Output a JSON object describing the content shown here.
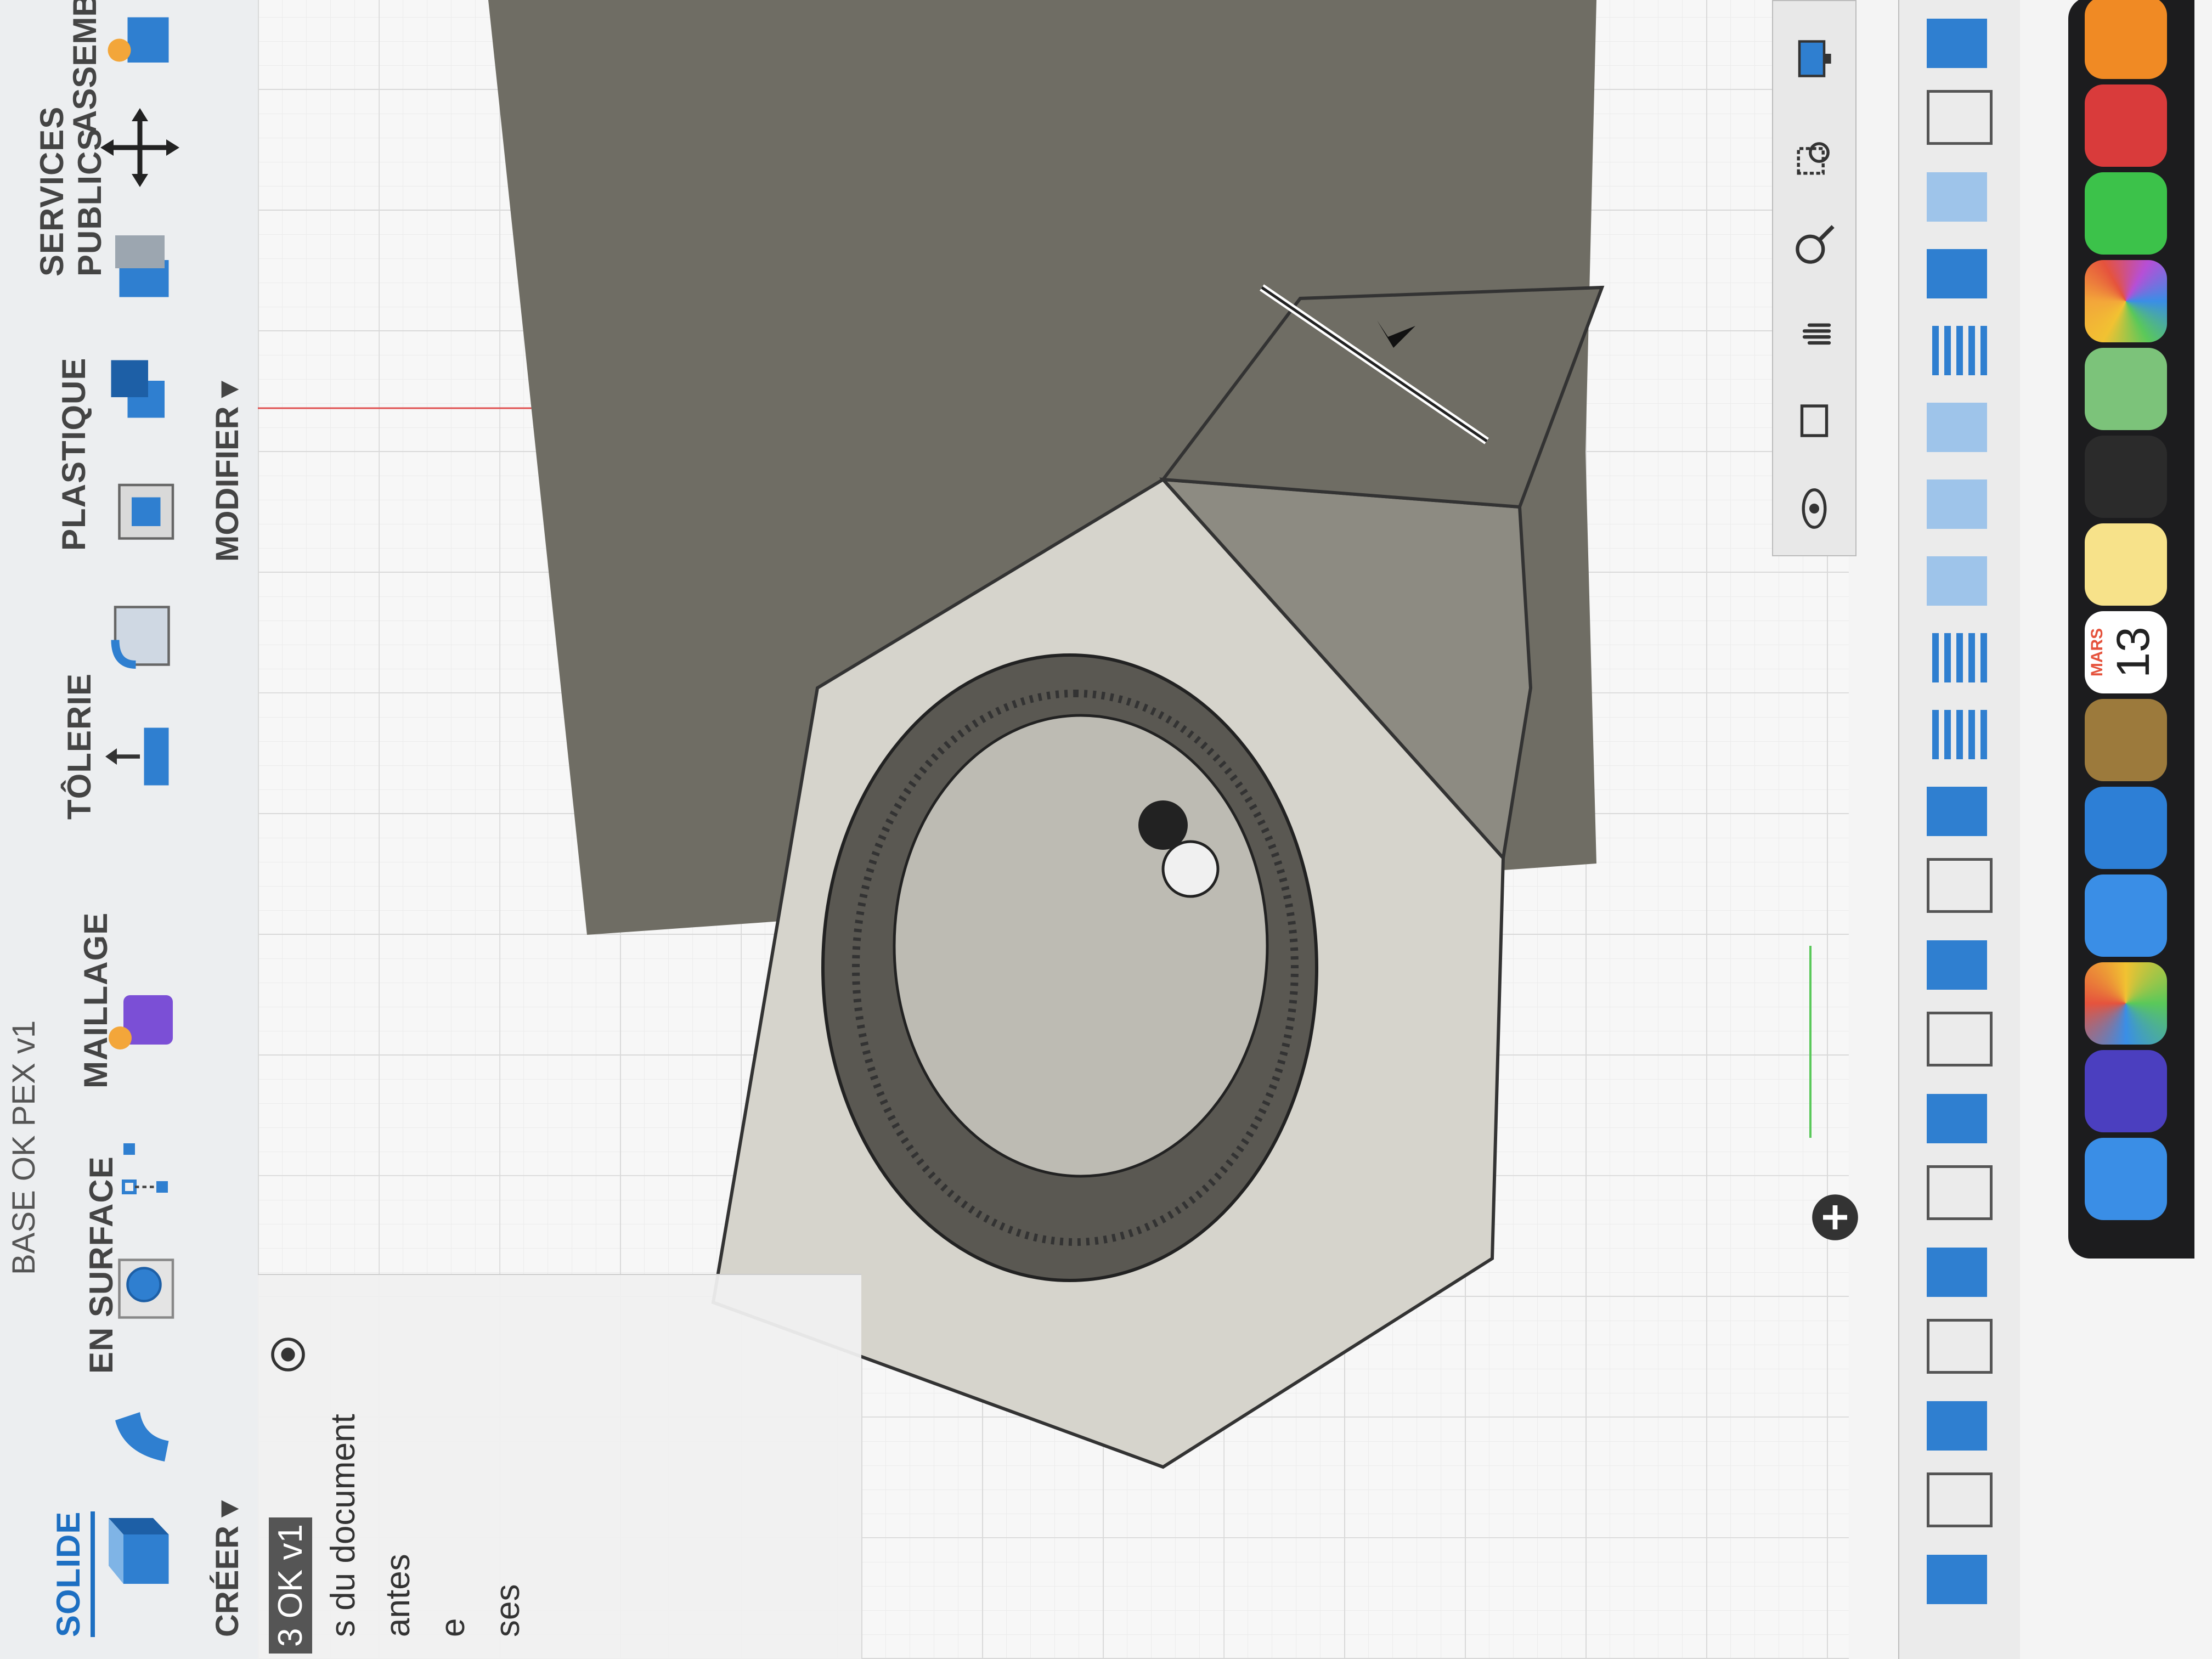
{
  "window": {
    "document_title": "BASE OK PEX v1"
  },
  "toolbar": {
    "tabs": [
      "SOLIDE",
      "EN SURFACE",
      "MAILLAGE",
      "TÔLERIE",
      "PLASTIQUE",
      "SERVICES PUBLICS"
    ],
    "groups": {
      "create": "CRÉER ▾",
      "modify": "MODIFIER ▾",
      "assemble": "ASSEMBLE"
    }
  },
  "browser": {
    "root_item": "3 OK v1",
    "lines": [
      "s du document",
      "antes",
      "e",
      "ses"
    ]
  },
  "dock": {
    "calendar_month": "MARS",
    "calendar_day": "13"
  },
  "colors": {
    "accent": "#1d6fc2",
    "model": "#8d8b82",
    "model_dark": "#6f6d64",
    "model_light": "#d2d0c8"
  }
}
